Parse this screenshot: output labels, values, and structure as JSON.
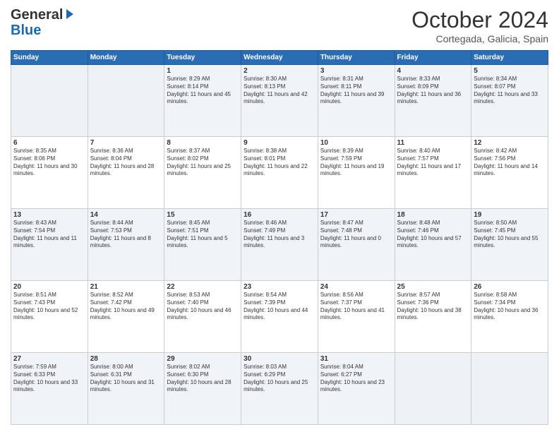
{
  "logo": {
    "general": "General",
    "blue": "Blue"
  },
  "header": {
    "month": "October 2024",
    "location": "Cortegada, Galicia, Spain"
  },
  "weekdays": [
    "Sunday",
    "Monday",
    "Tuesday",
    "Wednesday",
    "Thursday",
    "Friday",
    "Saturday"
  ],
  "weeks": [
    [
      {
        "day": "",
        "sunrise": "",
        "sunset": "",
        "daylight": ""
      },
      {
        "day": "",
        "sunrise": "",
        "sunset": "",
        "daylight": ""
      },
      {
        "day": "1",
        "sunrise": "Sunrise: 8:29 AM",
        "sunset": "Sunset: 8:14 PM",
        "daylight": "Daylight: 11 hours and 45 minutes."
      },
      {
        "day": "2",
        "sunrise": "Sunrise: 8:30 AM",
        "sunset": "Sunset: 8:13 PM",
        "daylight": "Daylight: 11 hours and 42 minutes."
      },
      {
        "day": "3",
        "sunrise": "Sunrise: 8:31 AM",
        "sunset": "Sunset: 8:11 PM",
        "daylight": "Daylight: 11 hours and 39 minutes."
      },
      {
        "day": "4",
        "sunrise": "Sunrise: 8:33 AM",
        "sunset": "Sunset: 8:09 PM",
        "daylight": "Daylight: 11 hours and 36 minutes."
      },
      {
        "day": "5",
        "sunrise": "Sunrise: 8:34 AM",
        "sunset": "Sunset: 8:07 PM",
        "daylight": "Daylight: 11 hours and 33 minutes."
      }
    ],
    [
      {
        "day": "6",
        "sunrise": "Sunrise: 8:35 AM",
        "sunset": "Sunset: 8:06 PM",
        "daylight": "Daylight: 11 hours and 30 minutes."
      },
      {
        "day": "7",
        "sunrise": "Sunrise: 8:36 AM",
        "sunset": "Sunset: 8:04 PM",
        "daylight": "Daylight: 11 hours and 28 minutes."
      },
      {
        "day": "8",
        "sunrise": "Sunrise: 8:37 AM",
        "sunset": "Sunset: 8:02 PM",
        "daylight": "Daylight: 11 hours and 25 minutes."
      },
      {
        "day": "9",
        "sunrise": "Sunrise: 8:38 AM",
        "sunset": "Sunset: 8:01 PM",
        "daylight": "Daylight: 11 hours and 22 minutes."
      },
      {
        "day": "10",
        "sunrise": "Sunrise: 8:39 AM",
        "sunset": "Sunset: 7:59 PM",
        "daylight": "Daylight: 11 hours and 19 minutes."
      },
      {
        "day": "11",
        "sunrise": "Sunrise: 8:40 AM",
        "sunset": "Sunset: 7:57 PM",
        "daylight": "Daylight: 11 hours and 17 minutes."
      },
      {
        "day": "12",
        "sunrise": "Sunrise: 8:42 AM",
        "sunset": "Sunset: 7:56 PM",
        "daylight": "Daylight: 11 hours and 14 minutes."
      }
    ],
    [
      {
        "day": "13",
        "sunrise": "Sunrise: 8:43 AM",
        "sunset": "Sunset: 7:54 PM",
        "daylight": "Daylight: 11 hours and 11 minutes."
      },
      {
        "day": "14",
        "sunrise": "Sunrise: 8:44 AM",
        "sunset": "Sunset: 7:53 PM",
        "daylight": "Daylight: 11 hours and 8 minutes."
      },
      {
        "day": "15",
        "sunrise": "Sunrise: 8:45 AM",
        "sunset": "Sunset: 7:51 PM",
        "daylight": "Daylight: 11 hours and 5 minutes."
      },
      {
        "day": "16",
        "sunrise": "Sunrise: 8:46 AM",
        "sunset": "Sunset: 7:49 PM",
        "daylight": "Daylight: 11 hours and 3 minutes."
      },
      {
        "day": "17",
        "sunrise": "Sunrise: 8:47 AM",
        "sunset": "Sunset: 7:48 PM",
        "daylight": "Daylight: 11 hours and 0 minutes."
      },
      {
        "day": "18",
        "sunrise": "Sunrise: 8:48 AM",
        "sunset": "Sunset: 7:46 PM",
        "daylight": "Daylight: 10 hours and 57 minutes."
      },
      {
        "day": "19",
        "sunrise": "Sunrise: 8:50 AM",
        "sunset": "Sunset: 7:45 PM",
        "daylight": "Daylight: 10 hours and 55 minutes."
      }
    ],
    [
      {
        "day": "20",
        "sunrise": "Sunrise: 8:51 AM",
        "sunset": "Sunset: 7:43 PM",
        "daylight": "Daylight: 10 hours and 52 minutes."
      },
      {
        "day": "21",
        "sunrise": "Sunrise: 8:52 AM",
        "sunset": "Sunset: 7:42 PM",
        "daylight": "Daylight: 10 hours and 49 minutes."
      },
      {
        "day": "22",
        "sunrise": "Sunrise: 8:53 AM",
        "sunset": "Sunset: 7:40 PM",
        "daylight": "Daylight: 10 hours and 46 minutes."
      },
      {
        "day": "23",
        "sunrise": "Sunrise: 8:54 AM",
        "sunset": "Sunset: 7:39 PM",
        "daylight": "Daylight: 10 hours and 44 minutes."
      },
      {
        "day": "24",
        "sunrise": "Sunrise: 8:56 AM",
        "sunset": "Sunset: 7:37 PM",
        "daylight": "Daylight: 10 hours and 41 minutes."
      },
      {
        "day": "25",
        "sunrise": "Sunrise: 8:57 AM",
        "sunset": "Sunset: 7:36 PM",
        "daylight": "Daylight: 10 hours and 38 minutes."
      },
      {
        "day": "26",
        "sunrise": "Sunrise: 8:58 AM",
        "sunset": "Sunset: 7:34 PM",
        "daylight": "Daylight: 10 hours and 36 minutes."
      }
    ],
    [
      {
        "day": "27",
        "sunrise": "Sunrise: 7:59 AM",
        "sunset": "Sunset: 6:33 PM",
        "daylight": "Daylight: 10 hours and 33 minutes."
      },
      {
        "day": "28",
        "sunrise": "Sunrise: 8:00 AM",
        "sunset": "Sunset: 6:31 PM",
        "daylight": "Daylight: 10 hours and 31 minutes."
      },
      {
        "day": "29",
        "sunrise": "Sunrise: 8:02 AM",
        "sunset": "Sunset: 6:30 PM",
        "daylight": "Daylight: 10 hours and 28 minutes."
      },
      {
        "day": "30",
        "sunrise": "Sunrise: 8:03 AM",
        "sunset": "Sunset: 6:29 PM",
        "daylight": "Daylight: 10 hours and 25 minutes."
      },
      {
        "day": "31",
        "sunrise": "Sunrise: 8:04 AM",
        "sunset": "Sunset: 6:27 PM",
        "daylight": "Daylight: 10 hours and 23 minutes."
      },
      {
        "day": "",
        "sunrise": "",
        "sunset": "",
        "daylight": ""
      },
      {
        "day": "",
        "sunrise": "",
        "sunset": "",
        "daylight": ""
      }
    ]
  ]
}
